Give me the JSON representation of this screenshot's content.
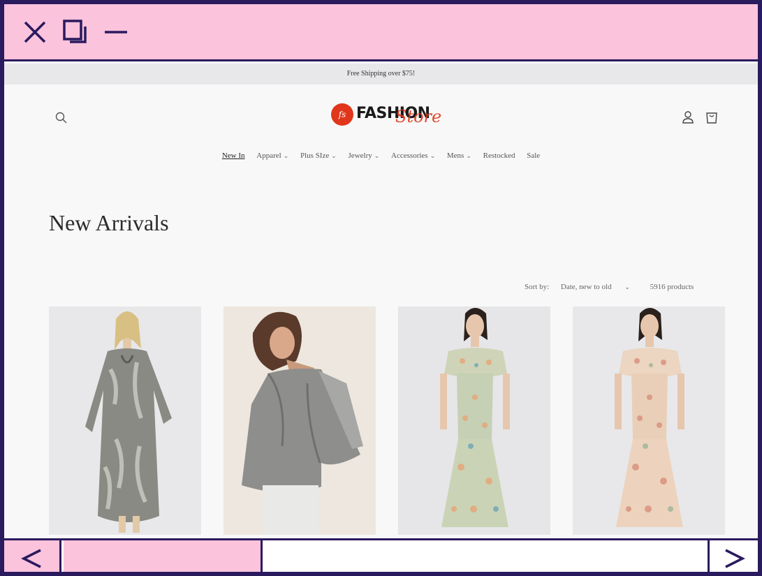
{
  "window": {
    "controls": [
      "close-icon",
      "maximize-icon",
      "minimize-icon"
    ],
    "accent": "#fcc3dd",
    "border": "#2a1a5e"
  },
  "promo": {
    "text": "Free Shipping over $75!"
  },
  "header": {
    "logo_badge": "fs",
    "logo_text": "FASHION",
    "logo_script": "Store"
  },
  "nav": {
    "items": [
      {
        "label": "New In",
        "dropdown": false,
        "active": true
      },
      {
        "label": "Apparel",
        "dropdown": true
      },
      {
        "label": "Plus SIze",
        "dropdown": true
      },
      {
        "label": "Jewelry",
        "dropdown": true
      },
      {
        "label": "Accessories",
        "dropdown": true
      },
      {
        "label": "Mens",
        "dropdown": true
      },
      {
        "label": "Restocked",
        "dropdown": false
      },
      {
        "label": "Sale",
        "dropdown": false
      }
    ]
  },
  "main": {
    "title": "New Arrivals",
    "sort_label": "Sort by:",
    "sort_value": "Date, new to old",
    "product_count": "5916 products"
  },
  "products": [
    {
      "name": "printed-maxi-dress"
    },
    {
      "name": "halter-neck-grey-top"
    },
    {
      "name": "off-shoulder-floral-maxi-blue"
    },
    {
      "name": "off-shoulder-floral-maxi-peach"
    }
  ]
}
